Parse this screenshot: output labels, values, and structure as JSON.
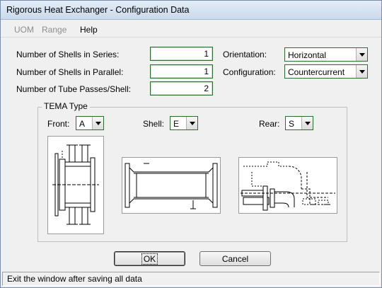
{
  "window": {
    "title": "Rigorous Heat Exchanger - Configuration Data"
  },
  "menu": {
    "items": [
      {
        "label": "UOM",
        "enabled": false
      },
      {
        "label": "Range",
        "enabled": false
      },
      {
        "label": "Help",
        "enabled": true
      }
    ]
  },
  "form": {
    "shells_series": {
      "label": "Number of Shells in Series:",
      "value": "1"
    },
    "shells_parallel": {
      "label": "Number of Shells in Parallel:",
      "value": "1"
    },
    "tube_passes": {
      "label": "Number of Tube Passes/Shell:",
      "value": "2"
    },
    "orientation": {
      "label": "Orientation:",
      "value": "Horizontal"
    },
    "configuration": {
      "label": "Configuration:",
      "value": "Countercurrent"
    }
  },
  "tema": {
    "title": "TEMA Type",
    "front": {
      "label": "Front:",
      "value": "A"
    },
    "shell": {
      "label": "Shell:",
      "value": "E"
    },
    "rear": {
      "label": "Rear:",
      "value": "S"
    }
  },
  "buttons": {
    "ok": "OK",
    "cancel": "Cancel"
  },
  "status": {
    "text": "Exit the window after saving all data"
  },
  "colors": {
    "input_border": "#2e6b2e",
    "window_bg": "#f0f0f0"
  }
}
